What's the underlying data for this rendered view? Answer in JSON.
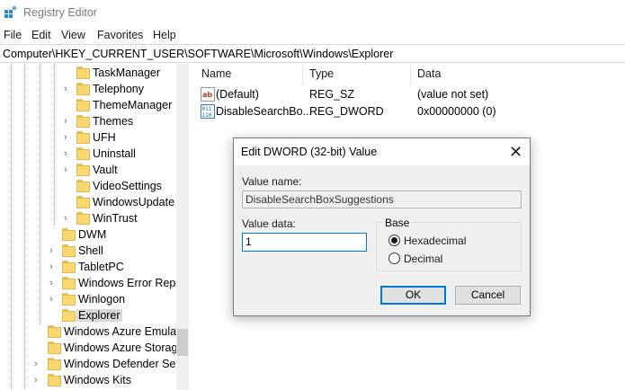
{
  "window": {
    "title": "Registry Editor"
  },
  "menu": [
    "File",
    "Edit",
    "View",
    "Favorites",
    "Help"
  ],
  "address": "Computer\\HKEY_CURRENT_USER\\SOFTWARE\\Microsoft\\Windows\\Explorer",
  "tree": [
    "TaskManager",
    "Telephony",
    "ThemeManager",
    "Themes",
    "UFH",
    "Uninstall",
    "Vault",
    "VideoSettings",
    "WindowsUpdate",
    "WinTrust",
    "DWM",
    "Shell",
    "TabletPC",
    "Windows Error Repo",
    "Winlogon",
    "Explorer",
    "Windows Azure Emulat",
    "Windows Azure Storage",
    "Windows Defender Sec",
    "Windows Kits"
  ],
  "columns": {
    "name": "Name",
    "type": "Type",
    "data": "Data"
  },
  "values": [
    {
      "name": "(Default)",
      "type": "REG_SZ",
      "data": "(value not set)",
      "icon": "string-value-icon"
    },
    {
      "name": "DisableSearchBo...",
      "type": "REG_DWORD",
      "data": "0x00000000 (0)",
      "icon": "binary-value-icon"
    }
  ],
  "dialog": {
    "title": "Edit DWORD (32-bit) Value",
    "value_name_label": "Value name:",
    "value_name": "DisableSearchBoxSuggestions",
    "value_data_label": "Value data:",
    "value_data": "1",
    "base_label": "Base",
    "hex_label": "Hexadecimal",
    "dec_label": "Decimal",
    "selected_base": "Hexadecimal",
    "ok_label": "OK",
    "cancel_label": "Cancel"
  }
}
